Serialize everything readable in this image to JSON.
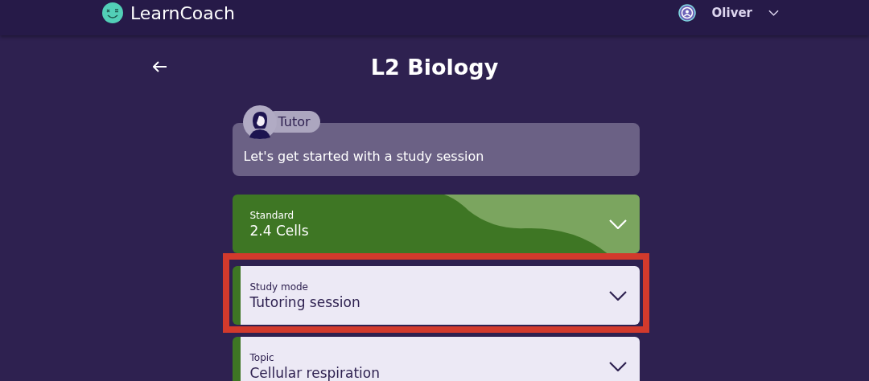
{
  "header": {
    "brand": "LearnCoach",
    "user": "Oliver"
  },
  "page": {
    "title": "L2 Biology"
  },
  "tutor": {
    "label": "Tutor",
    "message": "Let's get started with a study session"
  },
  "selectors": [
    {
      "kind": "filled",
      "label": "Standard",
      "value": "2.4 Cells",
      "highlighted": false
    },
    {
      "kind": "outlined",
      "label": "Study mode",
      "value": "Tutoring session",
      "highlighted": true
    },
    {
      "kind": "outlined",
      "label": "Topic",
      "value": "Cellular respiration",
      "highlighted": false
    }
  ]
}
